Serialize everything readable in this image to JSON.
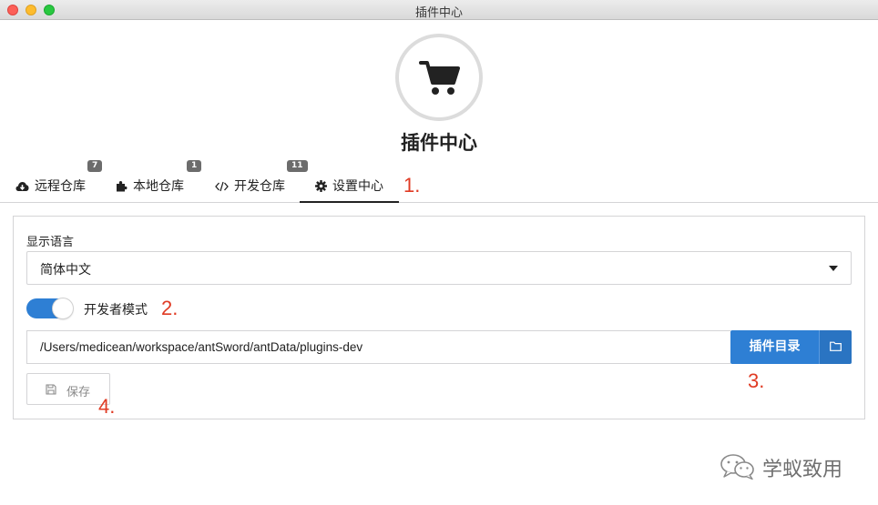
{
  "window": {
    "title": "插件中心"
  },
  "header": {
    "logo_icon": "shopping-cart-icon",
    "heading": "插件中心"
  },
  "tabs": [
    {
      "label": "远程仓库",
      "icon": "cloud-download-icon",
      "badge": "7",
      "active": false
    },
    {
      "label": "本地仓库",
      "icon": "puzzle-icon",
      "badge": "1",
      "active": false
    },
    {
      "label": "开发仓库",
      "icon": "code-icon",
      "badge": "11",
      "active": false
    },
    {
      "label": "设置中心",
      "icon": "gear-icon",
      "badge": "",
      "active": true
    }
  ],
  "annotations": {
    "a1": "1.",
    "a2": "2.",
    "a3": "3.",
    "a4": "4."
  },
  "settings": {
    "language_label": "显示语言",
    "language_value": "简体中文",
    "dev_mode_label": "开发者模式",
    "dev_mode_enabled": true,
    "plugin_path": "/Users/medicean/workspace/antSword/antData/plugins-dev",
    "plugin_dir_button": "插件目录",
    "save_button": "保存"
  },
  "watermark": {
    "text": "学蚁致用"
  },
  "colors": {
    "primary": "#2e7fd4",
    "annotation": "#e03b24",
    "badge": "#6c6c6c"
  }
}
